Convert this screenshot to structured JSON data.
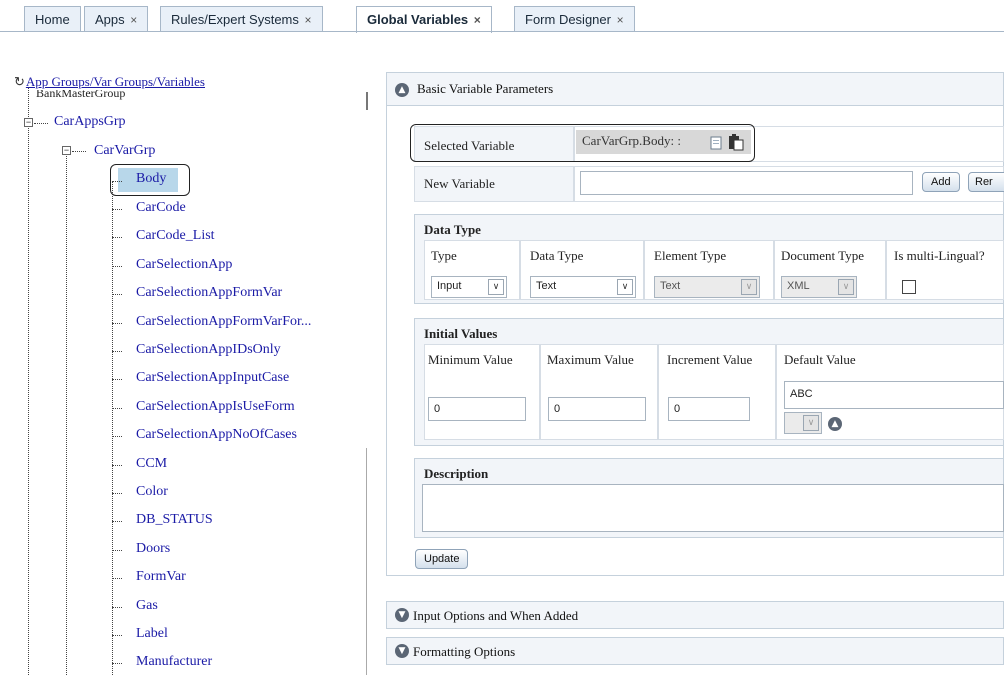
{
  "tabs": [
    {
      "label": "Home",
      "close": ""
    },
    {
      "label": "Apps",
      "close": "×"
    },
    {
      "label": "Rules/Expert Systems",
      "close": "×"
    },
    {
      "label": "Global Variables",
      "close": "×"
    },
    {
      "label": "Form Designer",
      "close": "×"
    }
  ],
  "tree": {
    "root_label": "App Groups/Var Groups/Variables",
    "root_icon": "refresh-icon",
    "clipped_item": "BankMasterGroup",
    "group": "CarAppsGrp",
    "subgroup": "CarVarGrp",
    "selected": "Body",
    "items": [
      "CarCode",
      "CarCode_List",
      "CarSelectionApp",
      "CarSelectionAppFormVar",
      "CarSelectionAppFormVarFor...",
      "CarSelectionAppIDsOnly",
      "CarSelectionAppInputCase",
      "CarSelectionAppIsUseForm",
      "CarSelectionAppNoOfCases",
      "CCM",
      "Color",
      "DB_STATUS",
      "Doors",
      "FormVar",
      "Gas",
      "Label",
      "Manufacturer"
    ],
    "collapse_glyph": "−"
  },
  "basic": {
    "title": "Basic Variable Parameters",
    "selected_variable_label": "Selected Variable",
    "selected_variable_value": "CarVarGrp.Body: :",
    "new_variable_label": "New Variable",
    "new_variable_value": "",
    "add_label": "Add",
    "rename_label": "Rer",
    "data_type_heading": "Data Type",
    "type_col": "Type",
    "data_type_col": "Data Type",
    "element_type_col": "Element Type",
    "document_type_col": "Document Type",
    "multilingual_col": "Is multi-Lingual?",
    "type_value": "Input",
    "data_type_value": "Text",
    "element_type_value": "Text",
    "document_type_value": "XML",
    "initial_values_heading": "Initial Values",
    "min_label": "Minimum Value",
    "max_label": "Maximum Value",
    "inc_label": "Increment Value",
    "default_label": "Default Value",
    "min_value": "0",
    "max_value": "0",
    "inc_value": "0",
    "default_value": "ABC",
    "description_heading": "Description",
    "description_value": "",
    "update_label": "Update"
  },
  "sections": [
    {
      "title": "Input Options and When Added"
    },
    {
      "title": "Formatting Options"
    }
  ],
  "colors": {
    "link": "#1a1aa6",
    "selection": "#b8d7ea",
    "panel_bg": "#f2f5f9",
    "border": "#c5d1dc"
  }
}
